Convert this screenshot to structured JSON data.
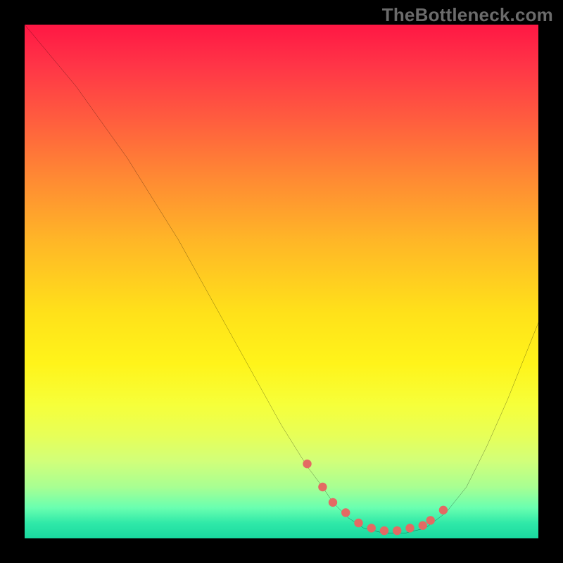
{
  "watermark": "TheBottleneck.com",
  "colors": {
    "background": "#000000",
    "watermark": "#6b6b6b",
    "curve": "#000000",
    "marker": "#e36a63",
    "gradient_stops": [
      "#ff1744",
      "#ff3547",
      "#ff5b3f",
      "#ff8a33",
      "#ffb627",
      "#ffe11a",
      "#fff41a",
      "#f6ff3a",
      "#e7ff58",
      "#d1ff7a",
      "#a8ff92",
      "#6affb0",
      "#30e9a8",
      "#19d9a0"
    ]
  },
  "chart_data": {
    "type": "line",
    "title": "",
    "xlabel": "",
    "ylabel": "",
    "xlim": [
      0,
      100
    ],
    "ylim": [
      0,
      100
    ],
    "grid": false,
    "legend": false,
    "series": [
      {
        "name": "bottleneck-curve",
        "x": [
          0,
          5,
          10,
          15,
          20,
          25,
          30,
          35,
          40,
          45,
          50,
          55,
          58,
          60,
          63,
          66,
          70,
          74,
          78,
          82,
          86,
          90,
          94,
          98,
          100
        ],
        "values": [
          100,
          94,
          88,
          81,
          74,
          66,
          58,
          49,
          40,
          31,
          22,
          14,
          10,
          7,
          4,
          2,
          1,
          1,
          2,
          5,
          10,
          18,
          27,
          37,
          42
        ]
      }
    ],
    "markers": {
      "name": "highlight-range",
      "x": [
        55,
        58,
        60,
        62.5,
        65,
        67.5,
        70,
        72.5,
        75,
        77.5,
        79,
        81.5
      ],
      "values": [
        14.5,
        10,
        7,
        5,
        3,
        2,
        1.5,
        1.5,
        2,
        2.5,
        3.5,
        5.5
      ]
    },
    "annotations": []
  }
}
